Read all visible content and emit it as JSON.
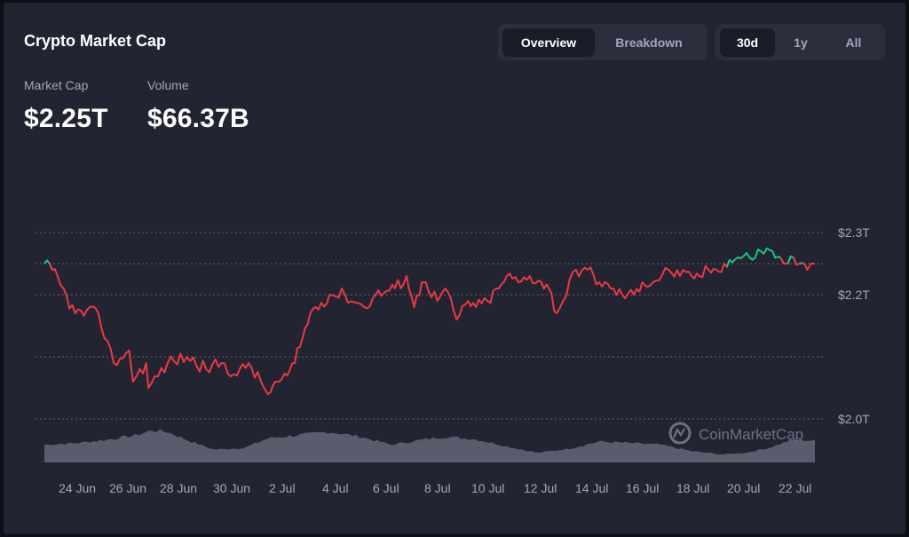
{
  "header": {
    "title": "Crypto Market Cap",
    "view_tabs": [
      "Overview",
      "Breakdown"
    ],
    "active_view": "Overview",
    "range_tabs": [
      "30d",
      "1y",
      "All"
    ],
    "active_range": "30d"
  },
  "metrics": [
    {
      "label": "Market Cap",
      "value": "$2.25T"
    },
    {
      "label": "Volume",
      "value": "$66.37B"
    }
  ],
  "watermark": "CoinMarketCap",
  "colors": {
    "background": "#222531",
    "line_down": "#ea3943",
    "line_up": "#16c784",
    "volume": "#585c6c",
    "text_secondary": "#a1a7bb"
  },
  "chart_data": {
    "type": "line",
    "title": "Crypto Market Cap",
    "y_axis": {
      "ticks": [
        {
          "value": 2.3,
          "label": "$2.3T"
        },
        {
          "value": 2.2,
          "label": "$2.2T"
        },
        {
          "value": 2.0,
          "label": "$2.0T"
        }
      ],
      "ylim": [
        2.0,
        2.3
      ],
      "unit": "trillion USD",
      "position": "right",
      "grid": "dotted"
    },
    "x_axis": {
      "ticks": [
        "24 Jun",
        "26 Jun",
        "28 Jun",
        "30 Jun",
        "2 Jul",
        "4 Jul",
        "6 Jul",
        "8 Jul",
        "10 Jul",
        "12 Jul",
        "14 Jul",
        "16 Jul",
        "18 Jul",
        "20 Jul",
        "22 Jul"
      ]
    },
    "reference_value": 2.25,
    "series": [
      {
        "name": "Market Cap",
        "x": [
          "22 Jun",
          "22.3 Jun",
          "23 Jun",
          "23.6 Jun",
          "24 Jun",
          "24.8 Jun",
          "25.2 Jun",
          "25.4 Jun",
          "25.9 Jun",
          "26 Jun",
          "26.4 Jun",
          "27 Jun",
          "27.6 Jun",
          "28 Jun",
          "28.8 Jun",
          "29.3 Jun",
          "29.8 Jun",
          "30 Jun",
          "30.4 Jun",
          "30.6 Jun",
          "1 Jul",
          "1.3 Jul",
          "1.6 Jul",
          "2 Jul",
          "2.5 Jul",
          "3 Jul",
          "3.5 Jul",
          "4 Jul",
          "4.6 Jul",
          "5 Jul",
          "5.5 Jul",
          "5.9 Jul",
          "6 Jul",
          "6.3 Jul",
          "6.6 Jul",
          "7 Jul",
          "7.4 Jul",
          "7.8 Jul",
          "8 Jul",
          "8.6 Jul",
          "9 Jul",
          "9.6 Jul",
          "10 Jul",
          "10.6 Jul",
          "11 Jul",
          "11.6 Jul",
          "12 Jul",
          "12.5 Jul",
          "13 Jul",
          "13.5 Jul",
          "14 Jul",
          "14.5 Jul",
          "14.8 Jul",
          "15 Jul",
          "15.5 Jul",
          "15.8 Jul",
          "16 Jul",
          "16.6 Jul",
          "17 Jul",
          "17.5 Jul",
          "18 Jul",
          "18.5 Jul",
          "19 Jul",
          "19.5 Jul",
          "20 Jul",
          "20.5 Jul",
          "20.7 Jul",
          "21 Jul",
          "21.2 Jul",
          "21.6 Jul",
          "22 Jul",
          "22.4 Jul",
          "22.7 Jul"
        ],
        "t": [
          0.0,
          0.01,
          0.04,
          0.07,
          0.09,
          0.11,
          0.115,
          0.12,
          0.132,
          0.135,
          0.16,
          0.185,
          0.21,
          0.23,
          0.25,
          0.265,
          0.285,
          0.29,
          0.3,
          0.305,
          0.315,
          0.325,
          0.335,
          0.345,
          0.37,
          0.39,
          0.415,
          0.43,
          0.455,
          0.47,
          0.48,
          0.49,
          0.495,
          0.51,
          0.52,
          0.535,
          0.55,
          0.56,
          0.575,
          0.59,
          0.6,
          0.615,
          0.63,
          0.645,
          0.655,
          0.665,
          0.69,
          0.705,
          0.72,
          0.735,
          0.75,
          0.765,
          0.776,
          0.79,
          0.81,
          0.825,
          0.84,
          0.85,
          0.862,
          0.872,
          0.882,
          0.9,
          0.915,
          0.93,
          0.945,
          0.955,
          0.96,
          0.965,
          0.972,
          0.98,
          0.99,
          0.995,
          1.0
        ],
        "values": [
          2.25,
          2.24,
          2.17,
          2.17,
          2.09,
          2.11,
          2.06,
          2.07,
          2.09,
          2.05,
          2.09,
          2.1,
          2.08,
          2.09,
          2.07,
          2.09,
          2.05,
          2.04,
          2.06,
          2.06,
          2.07,
          2.09,
          2.13,
          2.17,
          2.2,
          2.2,
          2.18,
          2.2,
          2.21,
          2.23,
          2.18,
          2.22,
          2.22,
          2.19,
          2.21,
          2.16,
          2.19,
          2.18,
          2.19,
          2.21,
          2.23,
          2.22,
          2.23,
          2.22,
          2.21,
          2.17,
          2.24,
          2.24,
          2.22,
          2.21,
          2.2,
          2.2,
          2.22,
          2.22,
          2.24,
          2.23,
          2.23,
          2.23,
          2.24,
          2.24,
          2.25,
          2.26,
          2.26,
          2.27,
          2.27,
          2.26,
          2.25,
          2.25,
          2.26,
          2.25,
          2.24,
          2.25,
          2.25
        ]
      },
      {
        "name": "Volume",
        "t": [
          0.0,
          0.04,
          0.08,
          0.12,
          0.14,
          0.16,
          0.19,
          0.22,
          0.26,
          0.29,
          0.33,
          0.37,
          0.41,
          0.45,
          0.49,
          0.52,
          0.56,
          0.6,
          0.64,
          0.68,
          0.72,
          0.76,
          0.8,
          0.84,
          0.88,
          0.91,
          0.94,
          0.97,
          1.0
        ],
        "relative_values": [
          0.55,
          0.6,
          0.7,
          0.85,
          1.0,
          0.95,
          0.65,
          0.4,
          0.45,
          0.75,
          0.85,
          0.95,
          0.8,
          0.55,
          0.7,
          0.8,
          0.72,
          0.5,
          0.3,
          0.42,
          0.65,
          0.6,
          0.55,
          0.35,
          0.25,
          0.3,
          0.45,
          0.7,
          0.68
        ]
      }
    ]
  }
}
